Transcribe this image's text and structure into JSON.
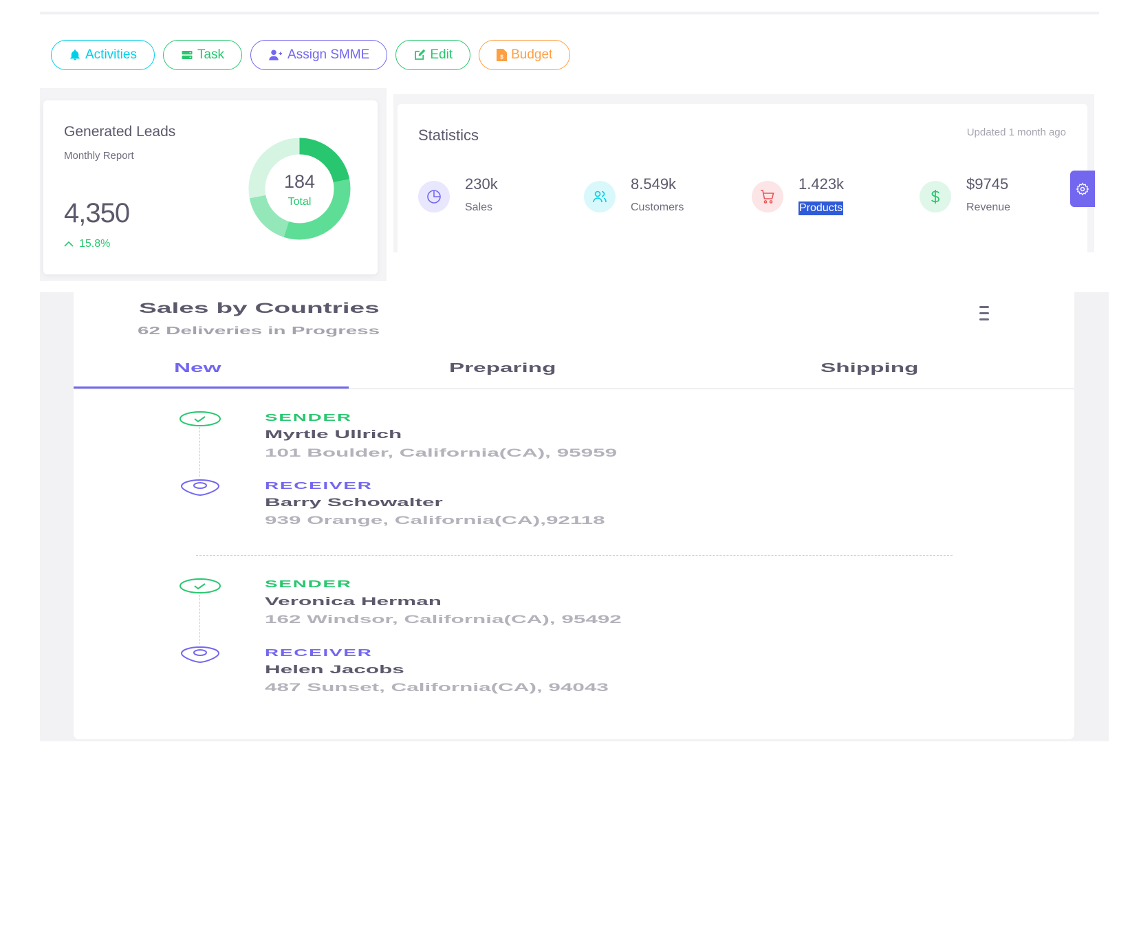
{
  "actions": [
    {
      "label": "Activities",
      "icon": "bell-icon",
      "color": "#00cfe8"
    },
    {
      "label": "Task",
      "icon": "server-icon",
      "color": "#28c76f"
    },
    {
      "label": "Assign SMME",
      "icon": "user-plus-icon",
      "color": "#7367f0"
    },
    {
      "label": "Edit",
      "icon": "edit-icon",
      "color": "#28c76f"
    },
    {
      "label": "Budget",
      "icon": "file-invoice-dollar-icon",
      "color": "#ff9f43"
    }
  ],
  "leads": {
    "title": "Generated Leads",
    "subtitle": "Monthly Report",
    "value": "4,350",
    "trend": "15.8%",
    "donut_total": "184",
    "donut_label": "Total",
    "donut_segments": [
      {
        "fraction": 0.22,
        "color": "#28c76f"
      },
      {
        "fraction": 0.33,
        "color": "#5edd96"
      },
      {
        "fraction": 0.17,
        "color": "#94e7b8"
      },
      {
        "fraction": 0.28,
        "color": "#d5f4e2"
      }
    ]
  },
  "statistics": {
    "title": "Statistics",
    "updated": "Updated 1 month ago",
    "items": [
      {
        "value": "230k",
        "label": "Sales",
        "icon": "pie-chart-icon",
        "color": "#7367f0",
        "bg": "#e8e7fd"
      },
      {
        "value": "8.549k",
        "label": "Customers",
        "icon": "users-icon",
        "color": "#00cfe8",
        "bg": "#d9f8fc"
      },
      {
        "value": "1.423k",
        "label": "Products",
        "icon": "shopping-cart-icon",
        "color": "#ea5455",
        "bg": "#fce5e6"
      },
      {
        "value": "$9745",
        "label": "Revenue",
        "icon": "dollar-icon",
        "color": "#28c76f",
        "bg": "#dff7e9"
      }
    ]
  },
  "sales": {
    "title": "Sales by Countries",
    "subtitle": "62 Deliveries in Progress",
    "tabs": [
      "New",
      "Preparing",
      "Shipping"
    ],
    "active_tab": "New",
    "deliveries": [
      {
        "sender_role": "SENDER",
        "sender_name": "Myrtle Ullrich",
        "sender_address": "101 Boulder, California(CA), 95959",
        "receiver_role": "RECEIVER",
        "receiver_name": "Barry Schowalter",
        "receiver_address": "939 Orange, California(CA),92118"
      },
      {
        "sender_role": "SENDER",
        "sender_name": "Veronica Herman",
        "sender_address": "162 Windsor, California(CA), 95492",
        "receiver_role": "RECEIVER",
        "receiver_name": "Helen Jacobs",
        "receiver_address": "487 Sunset, California(CA), 94043"
      }
    ]
  }
}
